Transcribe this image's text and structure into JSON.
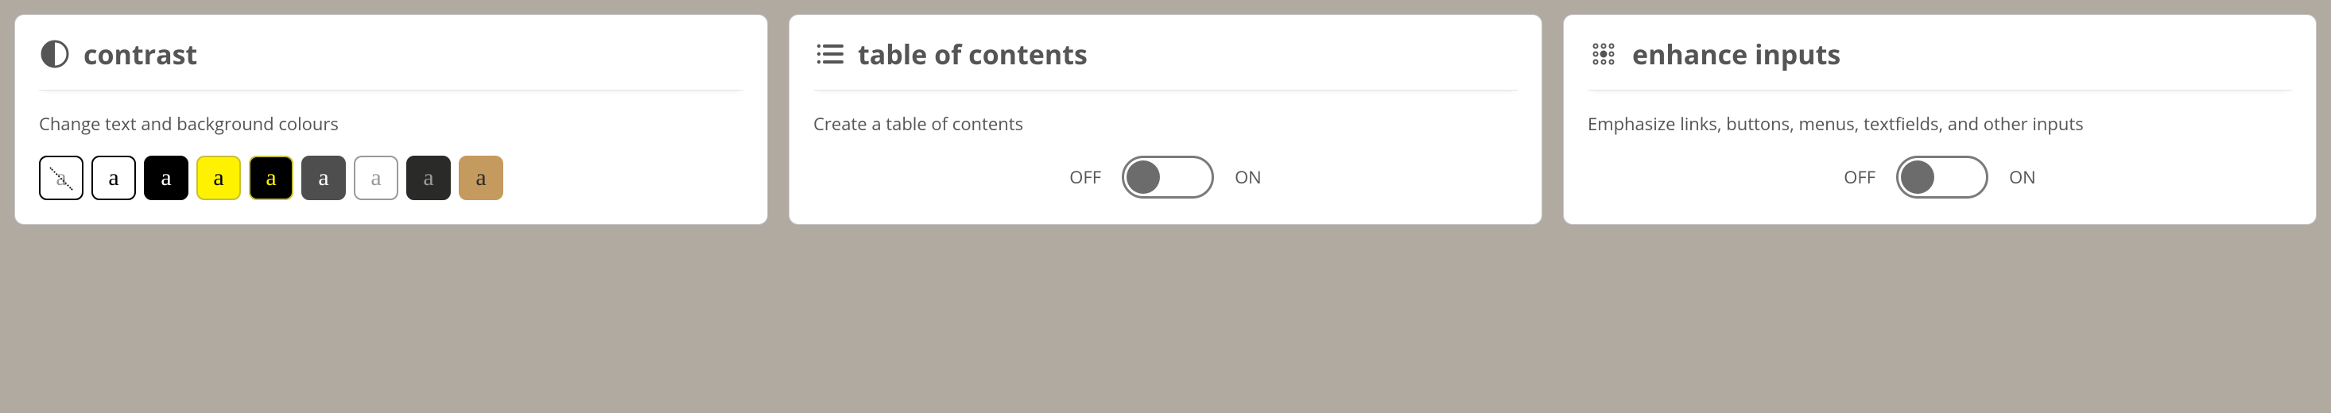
{
  "cards": {
    "contrast": {
      "title": "contrast",
      "description": "Change text and background colours",
      "swatches": [
        {
          "id": "none",
          "letter": "a",
          "bg": "#ffffff",
          "fg": "#9a9a9a",
          "border": "#000000",
          "strike": true
        },
        {
          "id": "white-black",
          "letter": "a",
          "bg": "#ffffff",
          "fg": "#000000",
          "border": "#000000"
        },
        {
          "id": "black-white",
          "letter": "a",
          "bg": "#000000",
          "fg": "#ffffff",
          "border": "#000000"
        },
        {
          "id": "yellow-black",
          "letter": "a",
          "bg": "#fff200",
          "fg": "#000000",
          "border": "#c7c037"
        },
        {
          "id": "black-yellow",
          "letter": "a",
          "bg": "#000000",
          "fg": "#fff200",
          "border": "#c7c037"
        },
        {
          "id": "grey-white",
          "letter": "a",
          "bg": "#4e4e4e",
          "fg": "#ffffff",
          "border": "#4e4e4e"
        },
        {
          "id": "white-grey",
          "letter": "a",
          "bg": "#ffffff",
          "fg": "#9a9a9a",
          "border": "#9a9a9a"
        },
        {
          "id": "dark-grey",
          "letter": "a",
          "bg": "#2a2a28",
          "fg": "#9a9a9a",
          "border": "#2a2a28"
        },
        {
          "id": "tan-black",
          "letter": "a",
          "bg": "#c49a5f",
          "fg": "#2c2c2c",
          "border": "#c49a5f"
        }
      ]
    },
    "toc": {
      "title": "table of contents",
      "description": "Create a table of contents",
      "toggle": {
        "off": "OFF",
        "on": "ON",
        "state": "off"
      }
    },
    "enhance": {
      "title": "enhance inputs",
      "description": "Emphasize links, buttons, menus, textfields, and other inputs",
      "toggle": {
        "off": "OFF",
        "on": "ON",
        "state": "off"
      }
    }
  }
}
